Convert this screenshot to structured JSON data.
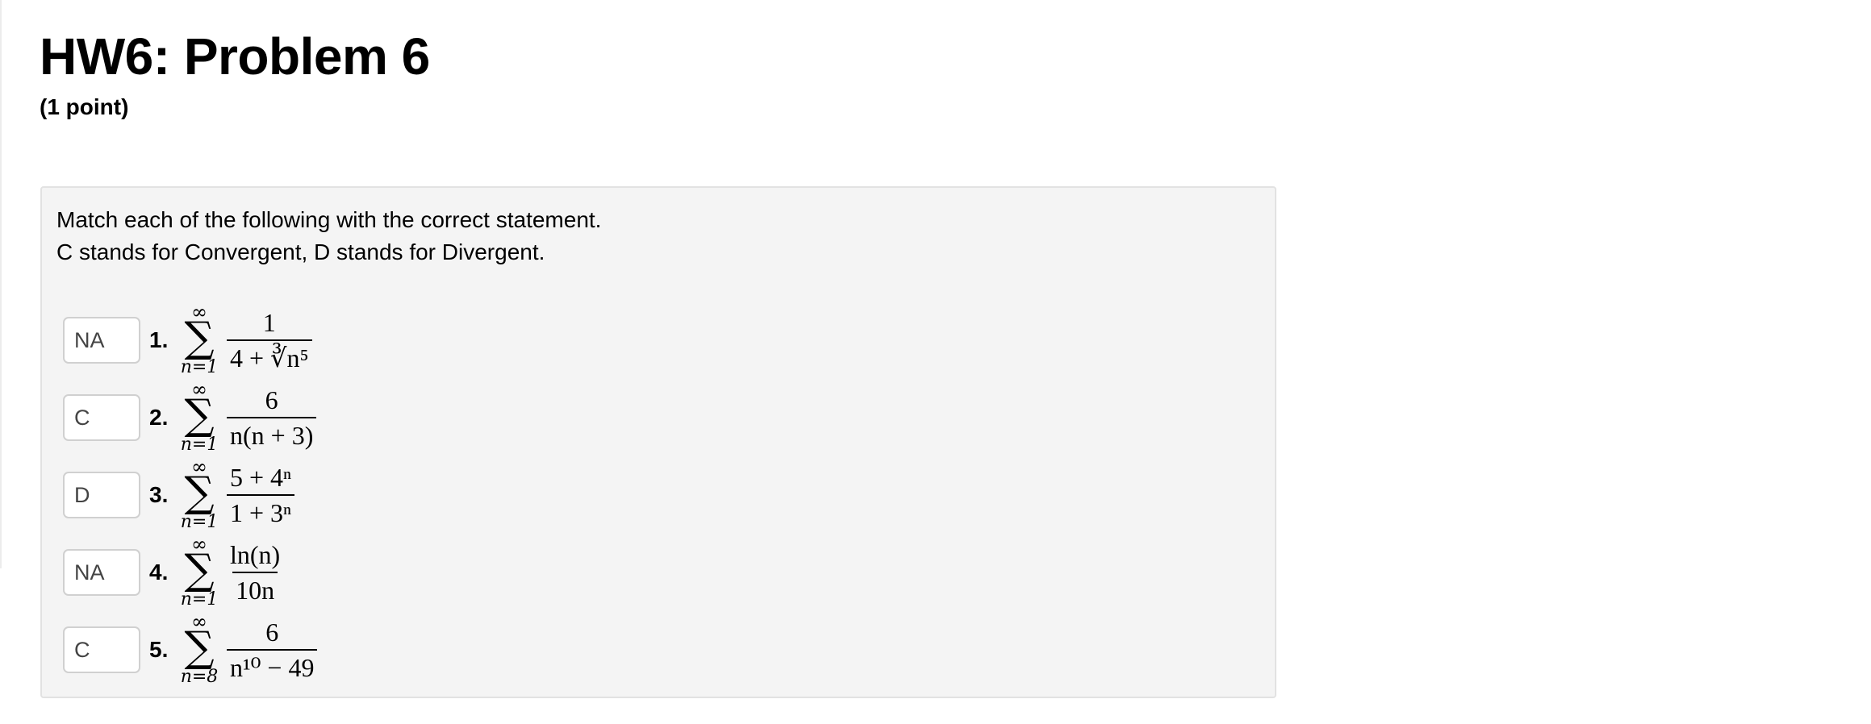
{
  "header": {
    "title": "HW6: Problem 6",
    "points": "(1 point)"
  },
  "problem": {
    "instruction_1": "Match each of the following with the correct statement.",
    "instruction_2": "C stands for Convergent, D stands for Divergent.",
    "items": [
      {
        "number": "1.",
        "answer": "NA",
        "upper": "∞",
        "lower": "n=1",
        "numerator": "1",
        "denominator": "4 + ∛n⁵"
      },
      {
        "number": "2.",
        "answer": "C",
        "upper": "∞",
        "lower": "n=1",
        "numerator": "6",
        "denominator": "n(n + 3)"
      },
      {
        "number": "3.",
        "answer": "D",
        "upper": "∞",
        "lower": "n=1",
        "numerator": "5 + 4ⁿ",
        "denominator": "1 + 3ⁿ"
      },
      {
        "number": "4.",
        "answer": "NA",
        "upper": "∞",
        "lower": "n=1",
        "numerator": "ln(n)",
        "denominator": "10n"
      },
      {
        "number": "5.",
        "answer": "C",
        "upper": "∞",
        "lower": "n=8",
        "numerator": "6",
        "denominator": "n¹⁰ − 49"
      }
    ]
  }
}
